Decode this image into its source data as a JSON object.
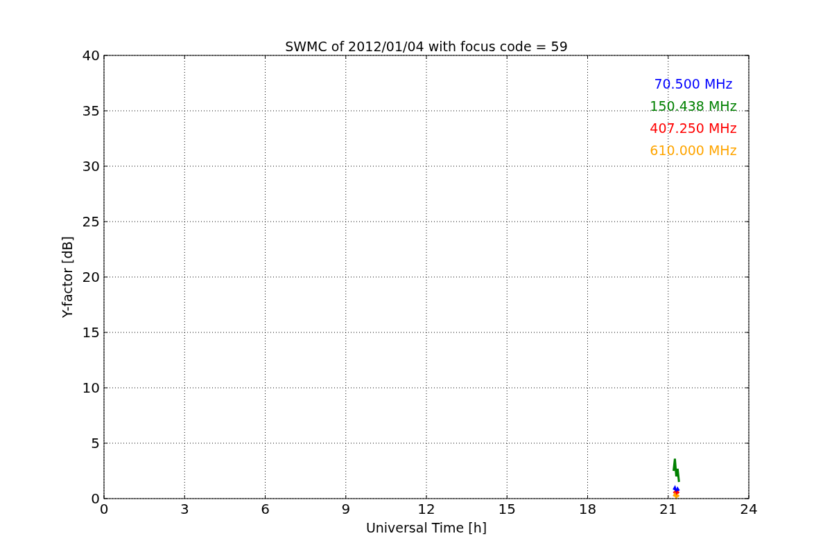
{
  "figure": {
    "chart_data": {
      "type": "line",
      "title": "SWMC of 2012/01/04 with focus code = 59",
      "xlabel": "Universal Time [h]",
      "ylabel": "Y-factor [dB]",
      "x": [
        21.2,
        21.25,
        21.3,
        21.35,
        21.4
      ],
      "series": [
        {
          "name": "70.500 MHz",
          "color": "#0000ff",
          "values": [
            0.8,
            1.0,
            0.6,
            0.9,
            0.7
          ]
        },
        {
          "name": "150.438 MHz",
          "color": "#008000",
          "values": [
            2.5,
            3.6,
            2.0,
            2.7,
            1.5
          ]
        },
        {
          "name": "407.250 MHz",
          "color": "#ff0000",
          "values": [
            0.5,
            0.6,
            0.4,
            0.6,
            0.5
          ]
        },
        {
          "name": "610.000 MHz",
          "color": "#ffa500",
          "values": [
            0.2,
            0.4,
            0.1,
            0.3,
            0.2
          ]
        }
      ],
      "xlim": [
        0,
        24
      ],
      "ylim": [
        0,
        40
      ],
      "xticks": [
        0,
        3,
        6,
        9,
        12,
        15,
        18,
        21,
        24
      ],
      "yticks": [
        0,
        5,
        10,
        15,
        20,
        25,
        30,
        35,
        40
      ],
      "grid": true
    }
  }
}
